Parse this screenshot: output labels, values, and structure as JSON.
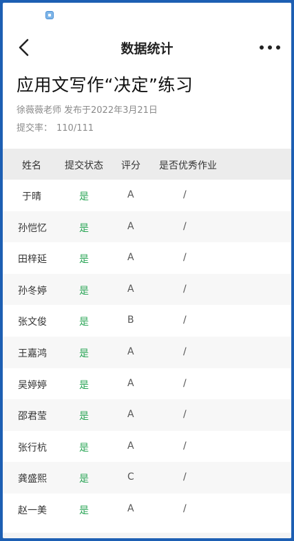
{
  "header": {
    "title": "数据统计"
  },
  "assignment": {
    "title": "应用文写作“决定”练习",
    "teacher": "徐薇薇老师",
    "published": "发布于2022年3月21日",
    "submit_label": "提交率：",
    "submit_rate": "110/111"
  },
  "table": {
    "columns": [
      "姓名",
      "提交状态",
      "评分",
      "是否优秀作业"
    ],
    "rows": [
      {
        "name": "于晴",
        "status": "是",
        "grade": "A",
        "excellent": "/"
      },
      {
        "name": "孙恺忆",
        "status": "是",
        "grade": "A",
        "excellent": "/"
      },
      {
        "name": "田梓延",
        "status": "是",
        "grade": "A",
        "excellent": "/"
      },
      {
        "name": "孙冬婷",
        "status": "是",
        "grade": "A",
        "excellent": "/"
      },
      {
        "name": "张文俊",
        "status": "是",
        "grade": "B",
        "excellent": "/"
      },
      {
        "name": "王嘉鸿",
        "status": "是",
        "grade": "A",
        "excellent": "/"
      },
      {
        "name": "吴婷婷",
        "status": "是",
        "grade": "A",
        "excellent": "/"
      },
      {
        "name": "邵君莹",
        "status": "是",
        "grade": "A",
        "excellent": "/"
      },
      {
        "name": "张行杭",
        "status": "是",
        "grade": "A",
        "excellent": "/"
      },
      {
        "name": "龚盛熙",
        "status": "是",
        "grade": "C",
        "excellent": "/"
      },
      {
        "name": "赵一美",
        "status": "是",
        "grade": "A",
        "excellent": "/"
      }
    ]
  },
  "colors": {
    "frame": "#1d5fb3",
    "status_yes": "#2aa556",
    "header_bg": "#ececec",
    "alt_row": "#f7f7f7"
  },
  "icons": {
    "status_bar": "app-notification-icon",
    "back": "chevron-left-icon",
    "more": "more-dots-icon"
  }
}
